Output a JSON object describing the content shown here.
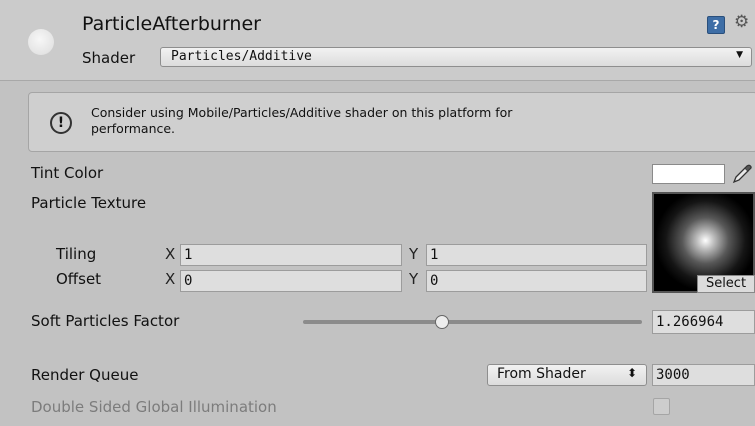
{
  "material": {
    "name": "ParticleAfterburner",
    "shader_label": "Shader",
    "shader_value": "Particles/Additive",
    "help_icon": "help-book-icon",
    "settings_icon": "gear-icon"
  },
  "warning": {
    "icon": "exclamation-circle-icon",
    "text_line1": "Consider using Mobile/Particles/Additive shader on this platform for",
    "text_line2": "performance."
  },
  "properties": {
    "tint_color_label": "Tint Color",
    "tint_color_value": "#ffffff",
    "particle_texture_label": "Particle Texture",
    "select_label": "Select",
    "tiling_label": "Tiling",
    "offset_label": "Offset",
    "x_axis": "X",
    "y_axis": "Y",
    "tiling_x": "1",
    "tiling_y": "1",
    "offset_x": "0",
    "offset_y": "0",
    "soft_particles_label": "Soft Particles Factor",
    "soft_particles_value": "1.266964",
    "soft_particles_fraction": 0.41,
    "render_queue_label": "Render Queue",
    "render_queue_mode": "From Shader",
    "render_queue_value": "3000",
    "dsgi_label": "Double Sided Global Illumination",
    "dsgi_checked": false
  }
}
